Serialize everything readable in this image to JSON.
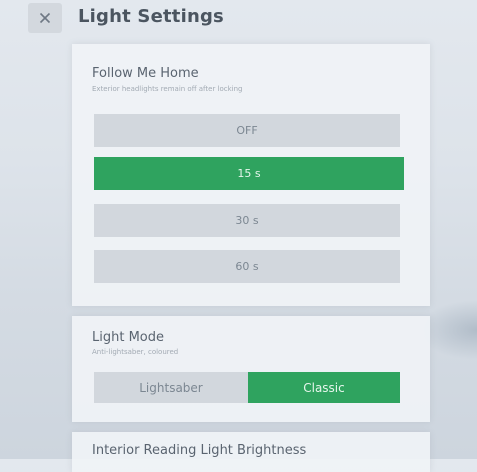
{
  "header": {
    "title": "Light Settings",
    "close_icon": "close-icon"
  },
  "follow_me_home": {
    "title": "Follow Me Home",
    "subtitle": "Exterior headlights remain off after locking",
    "options": [
      {
        "label": "OFF",
        "selected": false
      },
      {
        "label": "15 s",
        "selected": true
      },
      {
        "label": "30 s",
        "selected": false
      },
      {
        "label": "60 s",
        "selected": false
      }
    ]
  },
  "light_mode": {
    "title": "Light Mode",
    "subtitle": "Anti-lightsaber, coloured",
    "options": [
      {
        "label": "Lightsaber",
        "selected": false
      },
      {
        "label": "Classic",
        "selected": true
      }
    ]
  },
  "interior_reading": {
    "title": "Interior Reading Light Brightness"
  },
  "colors": {
    "accent": "#2fa35f",
    "option_bg": "#d2d7dd",
    "panel_bg": "#f0f3f6"
  }
}
